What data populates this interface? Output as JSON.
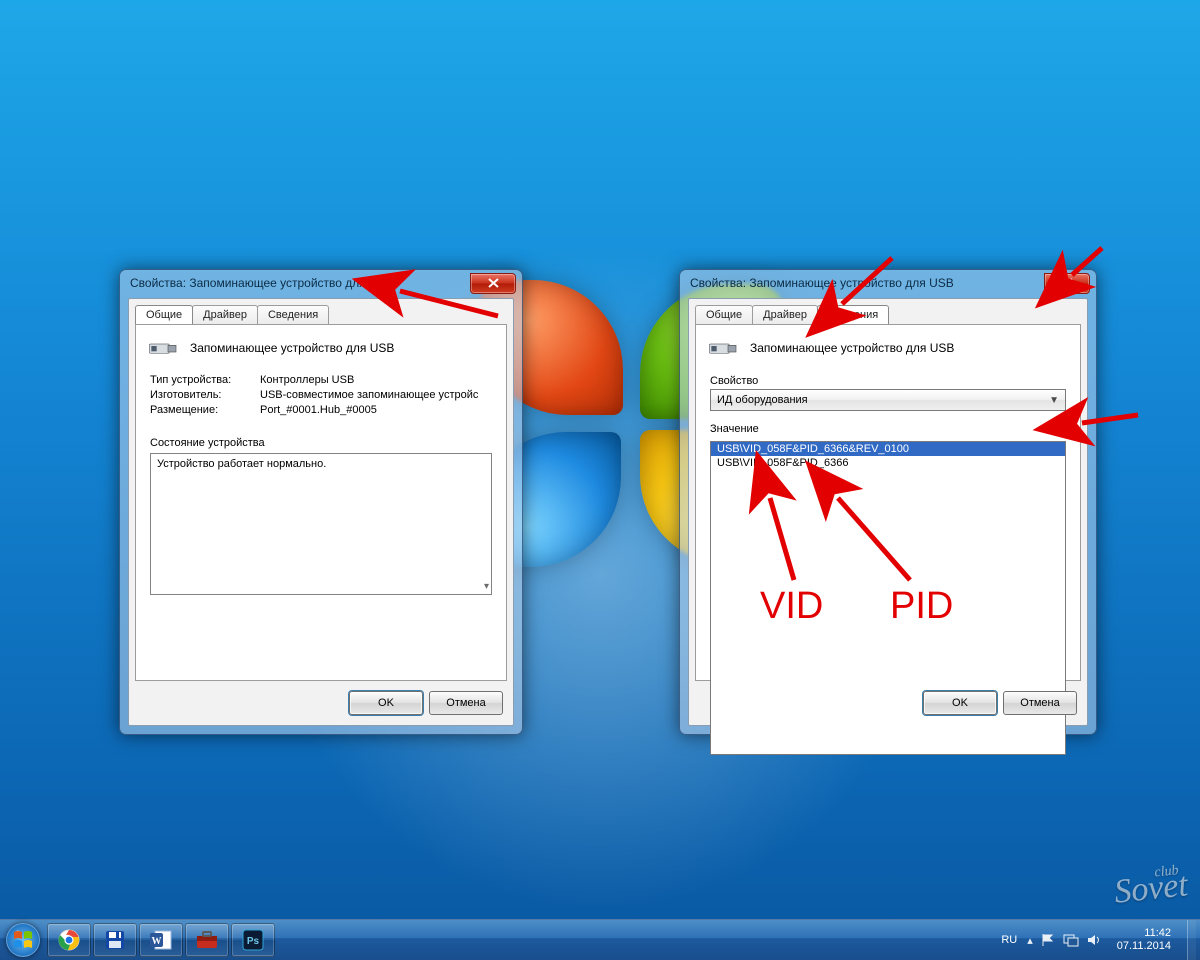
{
  "dialog_left": {
    "title": "Свойства: Запоминающее устройство для USB",
    "tabs": [
      "Общие",
      "Драйвер",
      "Сведения"
    ],
    "active_tab": 0,
    "device_name": "Запоминающее устройство для USB",
    "rows": {
      "type_k": "Тип устройства:",
      "type_v": "Контроллеры USB",
      "mfr_k": "Изготовитель:",
      "mfr_v": "USB-совместимое запоминающее устройс",
      "loc_k": "Размещение:",
      "loc_v": "Port_#0001.Hub_#0005"
    },
    "status_label": "Состояние устройства",
    "status_text": "Устройство работает нормально.",
    "ok": "OK",
    "cancel": "Отмена"
  },
  "dialog_right": {
    "title": "Свойства: Запоминающее устройство для USB",
    "tabs": [
      "Общие",
      "Драйвер",
      "Сведения"
    ],
    "active_tab": 2,
    "device_name": "Запоминающее устройство для USB",
    "property_label": "Свойство",
    "property_value": "ИД оборудования",
    "value_label": "Значение",
    "values": [
      "USB\\VID_058F&PID_6366&REV_0100",
      "USB\\VID_058F&PID_6366"
    ],
    "ok": "OK",
    "cancel": "Отмена"
  },
  "annotations": {
    "vid": "VID",
    "pid": "PID"
  },
  "tray": {
    "lang": "RU",
    "time": "11:42",
    "date": "07.11.2014"
  },
  "watermark": {
    "small": "club",
    "big": "Sovet"
  }
}
